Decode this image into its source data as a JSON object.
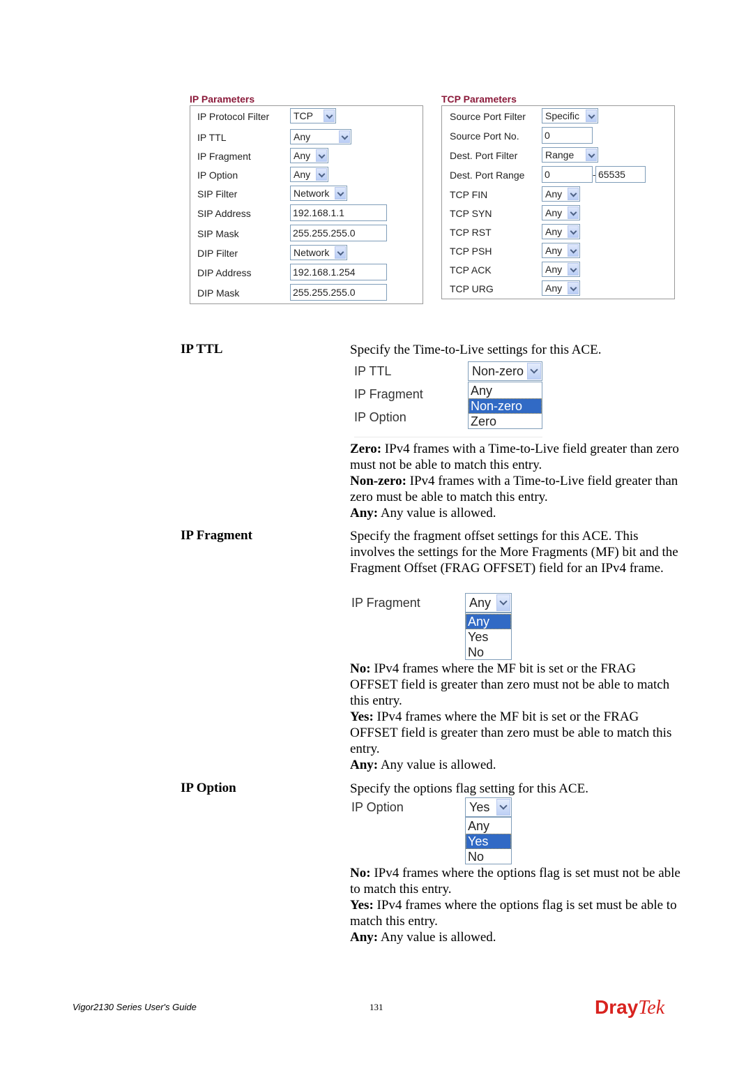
{
  "ip_parameters": {
    "title": "IP Parameters",
    "rows": [
      {
        "label": "IP Protocol Filter",
        "type": "select",
        "value": "TCP"
      },
      {
        "label": "IP TTL",
        "type": "select",
        "value": "Any"
      },
      {
        "label": "IP Fragment",
        "type": "select",
        "value": "Any"
      },
      {
        "label": "IP Option",
        "type": "select",
        "value": "Any"
      },
      {
        "label": "SIP Filter",
        "type": "select",
        "value": "Network"
      },
      {
        "label": "SIP Address",
        "type": "text",
        "value": "192.168.1.1"
      },
      {
        "label": "SIP Mask",
        "type": "text",
        "value": "255.255.255.0"
      },
      {
        "label": "DIP Filter",
        "type": "select",
        "value": "Network"
      },
      {
        "label": "DIP Address",
        "type": "text",
        "value": "192.168.1.254"
      },
      {
        "label": "DIP Mask",
        "type": "text",
        "value": "255.255.255.0"
      }
    ]
  },
  "tcp_parameters": {
    "title": "TCP Parameters",
    "rows": [
      {
        "label": "Source Port Filter",
        "type": "select",
        "value": "Specific"
      },
      {
        "label": "Source Port No.",
        "type": "text",
        "value": "0"
      },
      {
        "label": "Dest. Port Filter",
        "type": "select",
        "value": "Range"
      },
      {
        "label": "Dest. Port Range",
        "type": "range",
        "value": "0",
        "value2": "65535",
        "separator": "-"
      },
      {
        "label": "TCP FIN",
        "type": "select",
        "value": "Any"
      },
      {
        "label": "TCP SYN",
        "type": "select",
        "value": "Any"
      },
      {
        "label": "TCP RST",
        "type": "select",
        "value": "Any"
      },
      {
        "label": "TCP PSH",
        "type": "select",
        "value": "Any"
      },
      {
        "label": "TCP ACK",
        "type": "select",
        "value": "Any"
      },
      {
        "label": "TCP URG",
        "type": "select",
        "value": "Any"
      }
    ]
  },
  "sections": {
    "ip_ttl": {
      "term": "IP TTL",
      "intro": "Specify the Time-to-Live settings for this ACE.",
      "example": {
        "labels": [
          "IP TTL",
          "IP Fragment",
          "IP Option"
        ],
        "select_value": "Non-zero",
        "options": [
          "Any",
          "Non-zero",
          "Zero"
        ],
        "selected_index": 1
      },
      "defs": [
        {
          "k": "Zero:",
          "v": " IPv4 frames with a Time-to-Live field greater than zero must not be able to match this entry."
        },
        {
          "k": "Non-zero:",
          "v": " IPv4 frames with a Time-to-Live field greater than zero must be able to match this entry."
        },
        {
          "k": "Any:",
          "v": " Any value is allowed."
        }
      ]
    },
    "ip_fragment": {
      "term": "IP Fragment",
      "intro": "Specify the fragment offset settings for this ACE. This involves the settings for the More Fragments (MF) bit and the Fragment Offset (FRAG OFFSET) field for an IPv4 frame.",
      "example": {
        "label": "IP Fragment",
        "select_value": "Any",
        "options": [
          "Any",
          "Yes",
          "No"
        ],
        "selected_index": 0
      },
      "defs": [
        {
          "k": "No:",
          "v": " IPv4 frames where the MF bit is set or the FRAG OFFSET field is greater than zero must not be able to match this entry."
        },
        {
          "k": "Yes:",
          "v": " IPv4 frames where the MF bit is set or the FRAG OFFSET field is greater than zero must be able to match this entry."
        },
        {
          "k": "Any:",
          "v": " Any value is allowed."
        }
      ]
    },
    "ip_option": {
      "term": "IP Option",
      "intro": "Specify the options flag setting for this ACE.",
      "example": {
        "label": "IP Option",
        "select_value": "Yes",
        "options": [
          "Any",
          "Yes",
          "No"
        ],
        "selected_index": 1
      },
      "defs": [
        {
          "k": "No:",
          "v": " IPv4 frames where the options flag is set must not be able to match this entry."
        },
        {
          "k": "Yes:",
          "v": " IPv4 frames where the options flag is set must be able to match this entry."
        },
        {
          "k": "Any:",
          "v": " Any value is allowed."
        }
      ]
    }
  },
  "footer": {
    "guide": "Vigor2130 Series User's Guide",
    "page": "131",
    "logo_a": "Dray",
    "logo_b": "Tek"
  },
  "colors": {
    "section_title": "#8b1a3a",
    "selected_option": "#316ac5",
    "logo": "#d8231f"
  }
}
